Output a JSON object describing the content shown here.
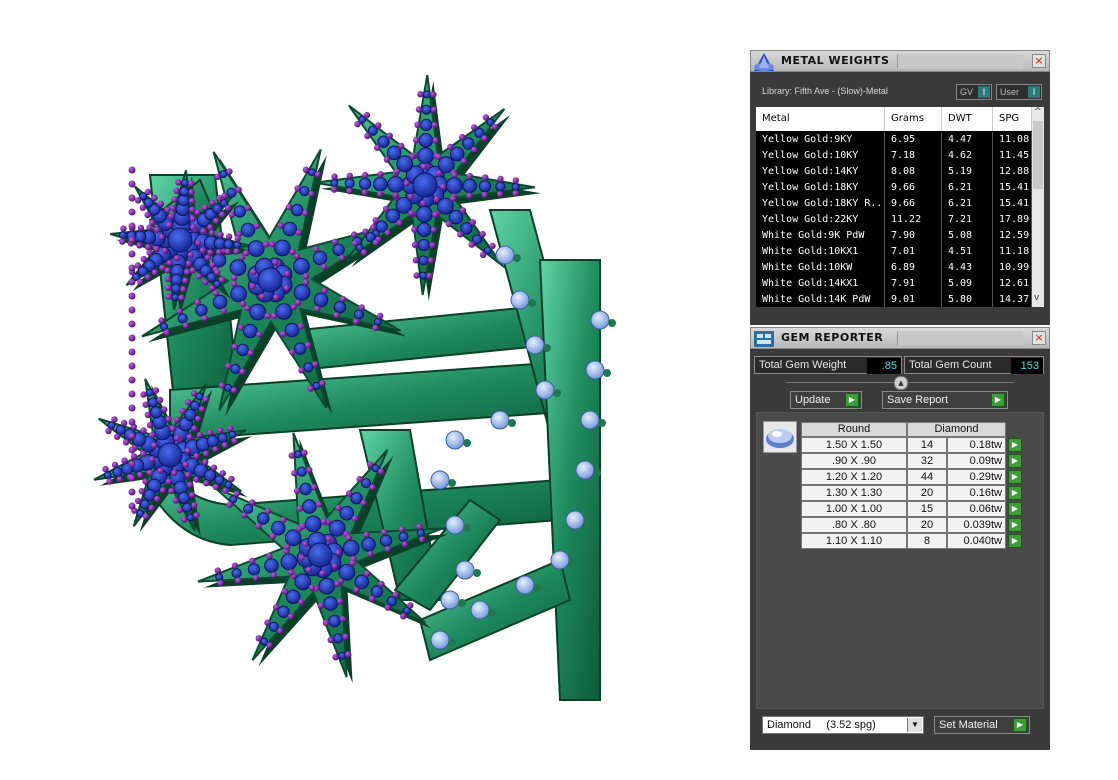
{
  "metal_weights": {
    "title": "METAL WEIGHTS",
    "close_label": "×",
    "library": "Library: Fifth Ave - (Slow)-Metal",
    "toggle_gv": "GV",
    "toggle_user": "User",
    "toggle_icon": "I",
    "columns": [
      "Metal",
      "Grams",
      "DWT",
      "SPG"
    ],
    "rows": [
      [
        "Yellow Gold:9KY",
        "6.95",
        "4.47",
        "11.08"
      ],
      [
        "Yellow Gold:10KY",
        "7.18",
        "4.62",
        "11.45"
      ],
      [
        "Yellow Gold:14KY",
        "8.08",
        "5.19",
        "12.88"
      ],
      [
        "Yellow Gold:18KY",
        "9.66",
        "6.21",
        "15.41"
      ],
      [
        "Yellow Gold:18KY R...",
        "9.66",
        "6.21",
        "15.41"
      ],
      [
        "Yellow Gold:22KY",
        "11.22",
        "7.21",
        "17.89"
      ],
      [
        "White Gold:9K PdW",
        "7.90",
        "5.08",
        "12.59"
      ],
      [
        "White Gold:10KX1",
        "7.01",
        "4.51",
        "11.18"
      ],
      [
        "White Gold:10KW",
        "6.89",
        "4.43",
        "10.99"
      ],
      [
        "White Gold:14KX1",
        "7.91",
        "5.09",
        "12.61"
      ],
      [
        "White Gold:14K PdW",
        "9.01",
        "5.80",
        "14.37"
      ]
    ],
    "scroll_up": "^",
    "scroll_down": "v",
    "scroll_left": "<",
    "scroll_right": ">"
  },
  "gem_reporter": {
    "title": "GEM REPORTER",
    "close_label": "×",
    "total_weight_label": "Total Gem Weight",
    "total_weight_value": ".85",
    "total_count_label": "Total Gem Count",
    "total_count_value": "153",
    "collapse_glyph": "▲",
    "update_label": "Update",
    "save_report_label": "Save Report",
    "go_glyph": "▶",
    "header_shape": "Round",
    "header_material": "Diamond",
    "rows": [
      {
        "size": "1.50 X 1.50",
        "count": "14",
        "weight": "0.18tw"
      },
      {
        "size": ".90 X .90",
        "count": "32",
        "weight": "0.09tw"
      },
      {
        "size": "1.20 X 1.20",
        "count": "44",
        "weight": "0.29tw"
      },
      {
        "size": "1.30 X 1.30",
        "count": "20",
        "weight": "0.16tw"
      },
      {
        "size": "1.00 X 1.00",
        "count": "15",
        "weight": "0.06tw"
      },
      {
        "size": ".80 X .80",
        "count": "20",
        "weight": "0.039tw"
      },
      {
        "size": "1.10 X 1.10",
        "count": "8",
        "weight": "0.040tw"
      }
    ],
    "material_select": "Diamond     (3.52 spg)",
    "dropdown_glyph": "▼",
    "set_material_label": "Set Material"
  },
  "colors": {
    "metal": "#1e8a5e",
    "metal_dark": "#0d5a3a",
    "metal_light": "#5fd6a6",
    "blue_gem": "#1a2fb8",
    "purple_prong": "#7a1f9e",
    "light_gem": "#a8c8ff"
  },
  "icons": {
    "metal_weights_logo": "metal-weights-logo-icon",
    "gem_reporter_logo": "gem-reporter-logo-icon",
    "gem_shape": "round-gem-icon"
  }
}
